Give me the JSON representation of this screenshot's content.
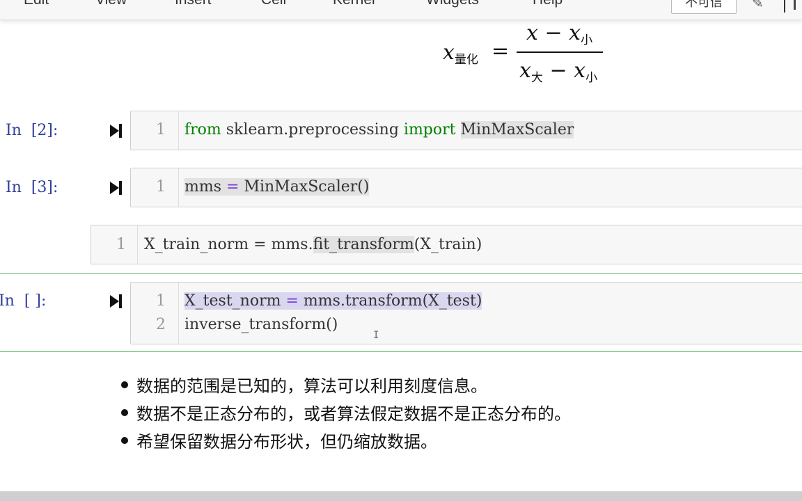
{
  "menu": {
    "items": [
      "Edit",
      "View",
      "Insert",
      "Cell",
      "Kernel",
      "Widgets",
      "Help"
    ],
    "trusted_label": "不可信"
  },
  "formula": {
    "lhs": "x",
    "lhs_sub": "量化",
    "equals": "=",
    "num_x": "x",
    "num_op": "−",
    "num_x2": "x",
    "num_sub": "小",
    "den_x": "x",
    "den_sub": "大",
    "den_op": "−",
    "den_x2": "x",
    "den_sub2": "小"
  },
  "cells": [
    {
      "prompt": "In  [2]:",
      "lines": [
        {
          "no": "1",
          "kw1": "from",
          "mid": " sklearn.preprocessing ",
          "kw2": "import",
          "name": "MinMaxScaler"
        }
      ]
    },
    {
      "prompt": "In  [3]:",
      "lines": [
        {
          "no": "1",
          "a": "mms",
          "op": " = ",
          "b": "MinMaxScaler()"
        }
      ]
    },
    {
      "prompt": "",
      "lines": [
        {
          "no": "1",
          "a": "X_train_norm",
          "op": " = ",
          "b": "mms.",
          "c": "fit_transform",
          "d": "(X_train)"
        }
      ]
    },
    {
      "prompt": "In  [ ]:",
      "lines": [
        {
          "no": "1",
          "a": "X_test_norm",
          "op": " = ",
          "b": "mms.transform(X_test)"
        },
        {
          "no": "2",
          "text": "inverse_transform()"
        }
      ]
    }
  ],
  "bullets": [
    "数据的范围是已知的，算法可以利用刻度信息。",
    "数据不是正态分布的，或者算法假定数据不是正态分布的。",
    "希望保留数据分布形状，但仍缩放数据。"
  ]
}
